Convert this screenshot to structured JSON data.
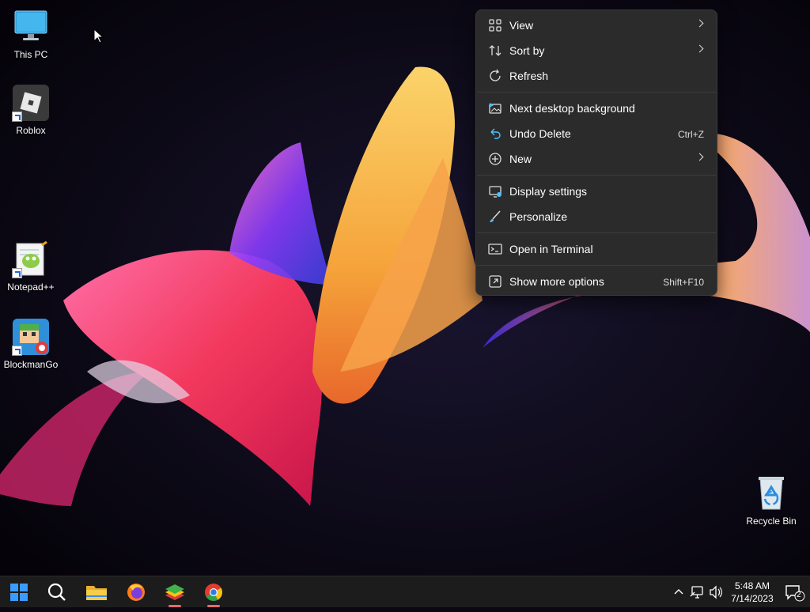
{
  "desktop": {
    "icons": [
      {
        "label": "This PC",
        "icon": "monitor-icon"
      },
      {
        "label": "Roblox",
        "icon": "roblox-icon"
      },
      {
        "label": "Notepad++",
        "icon": "notepad-plus-plus-icon"
      },
      {
        "label": "BlockmanGo",
        "icon": "blockmango-icon"
      },
      {
        "label": "Recycle Bin",
        "icon": "recycle-bin-icon"
      }
    ]
  },
  "context_menu": {
    "items": [
      {
        "label": "View",
        "icon": "grid-icon",
        "submenu": true
      },
      {
        "label": "Sort by",
        "icon": "sort-icon",
        "submenu": true
      },
      {
        "label": "Refresh",
        "icon": "refresh-icon"
      },
      {
        "label": "Next desktop background",
        "icon": "next-background-icon"
      },
      {
        "label": "Undo Delete",
        "icon": "undo-icon",
        "shortcut": "Ctrl+Z"
      },
      {
        "label": "New",
        "icon": "plus-circle-icon",
        "submenu": true
      },
      {
        "label": "Display settings",
        "icon": "display-icon"
      },
      {
        "label": "Personalize",
        "icon": "brush-icon"
      },
      {
        "label": "Open in Terminal",
        "icon": "terminal-icon"
      },
      {
        "label": "Show more options",
        "icon": "more-options-icon",
        "shortcut": "Shift+F10"
      }
    ]
  },
  "taskbar": {
    "apps": [
      "start-icon",
      "search-icon",
      "file-explorer-icon",
      "firefox-icon",
      "bluestacks-icon",
      "chrome-icon"
    ],
    "clock_time": "5:48 AM",
    "clock_date": "7/14/2023",
    "notification_count": "2"
  },
  "colors": {
    "menu_bg": "#2b2b2b",
    "taskbar_bg": "#1c1c1c",
    "accent": "#4cc2ff"
  }
}
